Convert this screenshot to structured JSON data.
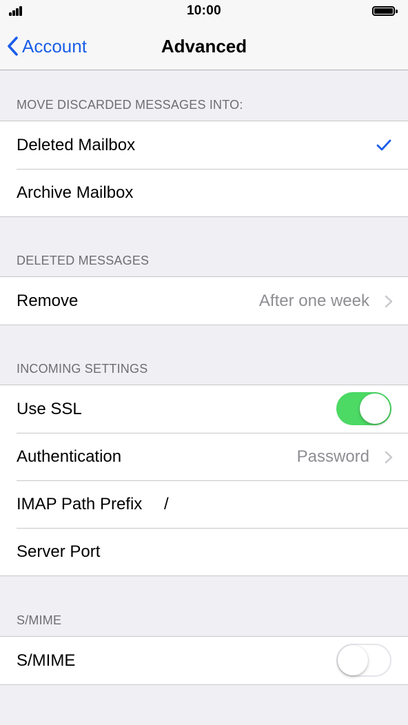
{
  "status_bar": {
    "time": "10:00"
  },
  "nav": {
    "back_label": "Account",
    "title": "Advanced"
  },
  "sections": {
    "discarded": {
      "header": "MOVE DISCARDED MESSAGES INTO:",
      "rows": [
        {
          "label": "Deleted Mailbox",
          "selected": true
        },
        {
          "label": "Archive Mailbox",
          "selected": false
        }
      ]
    },
    "deleted": {
      "header": "DELETED MESSAGES",
      "rows": [
        {
          "label": "Remove",
          "value": "After one week"
        }
      ]
    },
    "incoming": {
      "header": "INCOMING SETTINGS",
      "rows": [
        {
          "label": "Use SSL",
          "toggle": true
        },
        {
          "label": "Authentication",
          "value": "Password"
        },
        {
          "label": "IMAP Path Prefix",
          "value": "/"
        },
        {
          "label": "Server Port",
          "value": ""
        }
      ]
    },
    "smime": {
      "header": "S/MIME",
      "rows": [
        {
          "label": "S/MIME",
          "toggle": false
        }
      ]
    }
  },
  "colors": {
    "accent": "#1a5ee8",
    "toggle_on": "#4cd964",
    "background": "#efeff4",
    "secondary_text": "#8e8e93"
  }
}
